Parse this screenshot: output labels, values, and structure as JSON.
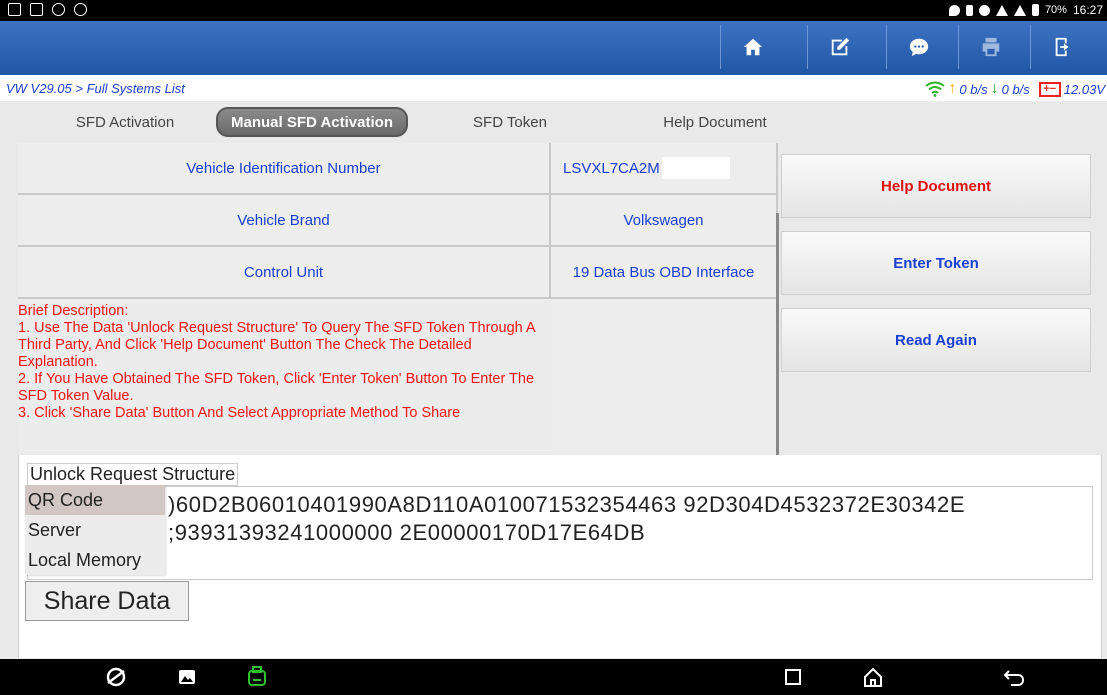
{
  "status_bar": {
    "battery": "70%",
    "time": "16:27"
  },
  "breadcrumb": "VW V29.05 > Full Systems List",
  "connection": {
    "upload": "0 b/s",
    "download": "0 b/s",
    "voltage": "12.03V"
  },
  "tabs": [
    {
      "label": "SFD Activation"
    },
    {
      "label": "Manual SFD Activation"
    },
    {
      "label": "SFD Token"
    },
    {
      "label": "Help Document"
    }
  ],
  "info_table": [
    {
      "label": "Vehicle Identification Number",
      "value": "LSVXL7CA2M"
    },
    {
      "label": "Vehicle Brand",
      "value": "Volkswagen"
    },
    {
      "label": "Control Unit",
      "value": "19 Data Bus OBD Interface"
    }
  ],
  "description": {
    "title": "Brief Description:",
    "lines": [
      "1. Use The Data 'Unlock Request Structure' To Query The SFD Token Through A Third Party, And Click 'Help Document' Button The Check The Detailed Explanation.",
      "2. If You Have Obtained The SFD Token, Click 'Enter Token' Button To Enter The SFD Token Value.",
      "3. Click 'Share Data' Button And Select Appropriate Method To Share"
    ]
  },
  "side_buttons": {
    "help": "Help Document",
    "enter_token": "Enter Token",
    "read_again": "Read Again"
  },
  "unlock": {
    "label": "Unlock Request Structure",
    "line1": ")60D2B06010401990A8D110A010071532354463 92D304D4532372E30342E",
    "line2": ";93931393241000000 2E00000170D17E64DB"
  },
  "share_menu": [
    "QR Code",
    "Server",
    "Local Memory"
  ],
  "share_button": "Share Data"
}
